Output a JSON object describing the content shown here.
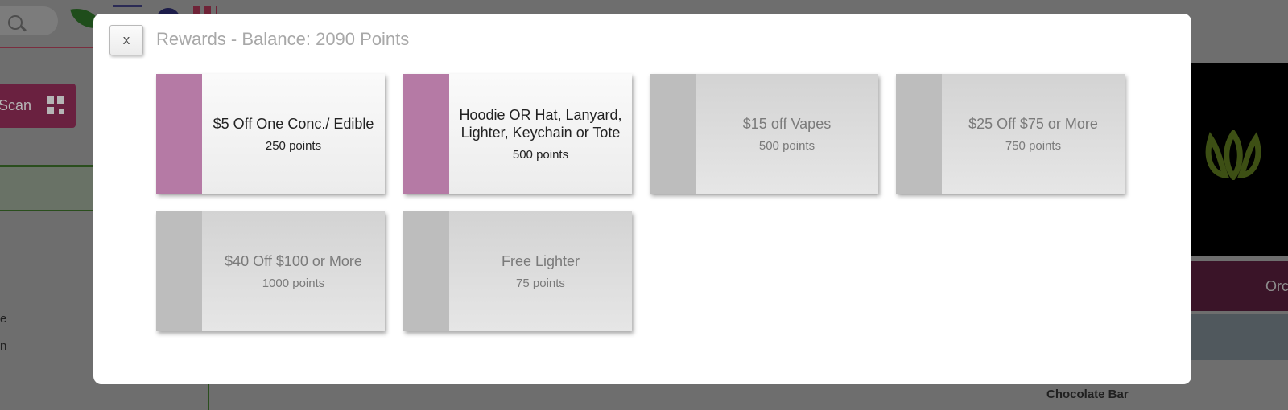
{
  "background": {
    "scan_label": "Scan",
    "side_text_1": "e",
    "side_text_2": "n",
    "order_label": "Orc",
    "product_name": "Chocolate Bar"
  },
  "modal": {
    "close_label": "x",
    "title": "Rewards - Balance: 2090 Points",
    "rewards": [
      {
        "name": "$5 Off One Conc./ Edible",
        "points": "250 points",
        "available": true
      },
      {
        "name": "Hoodie OR Hat, Lanyard, Lighter, Keychain or Tote",
        "points": "500 points",
        "available": true
      },
      {
        "name": "$15 off Vapes",
        "points": "500 points",
        "available": false
      },
      {
        "name": "$25 Off $75 or More",
        "points": "750 points",
        "available": false
      },
      {
        "name": "$40 Off $100 or More",
        "points": "1000 points",
        "available": false
      },
      {
        "name": "Free Lighter",
        "points": "75 points",
        "available": false
      }
    ]
  },
  "colors": {
    "accent": "#b57aa5",
    "disabled_stripe": "#bdbdbd",
    "overlay": "#6e6e6e"
  }
}
